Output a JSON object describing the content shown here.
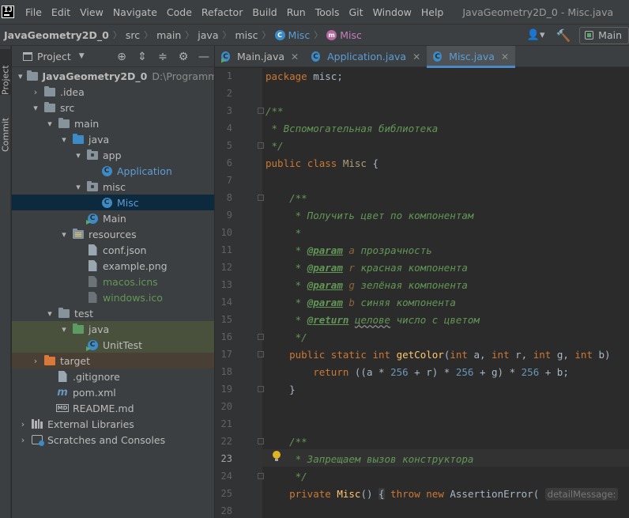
{
  "menubar": {
    "items": [
      "File",
      "Edit",
      "View",
      "Navigate",
      "Code",
      "Refactor",
      "Build",
      "Run",
      "Tools",
      "Git",
      "Window",
      "Help"
    ],
    "window_title": "JavaGeometry2D_0 - Misc.java"
  },
  "breadcrumb": {
    "project": "JavaGeometry2D_0",
    "parts": [
      "src",
      "main",
      "java",
      "misc"
    ],
    "class_c": "Misc",
    "class_m": "Misc"
  },
  "run_config": {
    "label": "Main"
  },
  "toolstrip": {
    "project_tab": "Project",
    "commit_tab": "Commit"
  },
  "project_panel": {
    "title": "Project",
    "tree": {
      "root_name": "JavaGeometry2D_0",
      "root_path": "D:\\Programming\\J",
      "idea": ".idea",
      "src": "src",
      "main": "main",
      "java": "java",
      "app": "app",
      "application": "Application",
      "misc": "misc",
      "misc_class": "Misc",
      "main_class": "Main",
      "resources": "resources",
      "conf": "conf.json",
      "example": "example.png",
      "macos": "macos.icns",
      "windows": "windows.ico",
      "test": "test",
      "test_java": "java",
      "unittest": "UnitTest",
      "target": "target",
      "gitignore": ".gitignore",
      "pom": "pom.xml",
      "readme": "README.md",
      "external": "External Libraries",
      "scratches": "Scratches and Consoles"
    }
  },
  "editor_tabs": [
    {
      "label": "Main.java"
    },
    {
      "label": "Application.java"
    },
    {
      "label": "Misc.java"
    }
  ],
  "editor": {
    "current_line": 23,
    "line_numbers": [
      "1",
      "2",
      "3",
      "4",
      "5",
      "6",
      "7",
      "8",
      "9",
      "10",
      "11",
      "12",
      "13",
      "14",
      "15",
      "16",
      "17",
      "18",
      "19",
      "20",
      "21",
      "22",
      "23",
      "24",
      "25",
      "28"
    ],
    "code": {
      "l1_kw": "package",
      "l1_rest": " misc;",
      "l3": "/**",
      "l4": " * Вспомогательная библиотека",
      "l5": " */",
      "l6_kw1": "public",
      "l6_kw2": "class",
      "l6_name": "Misc",
      "l6_rest": " {",
      "l8": "/**",
      "l9": " * Получить цвет по компонентам",
      "l10": " *",
      "p_tag": "@param",
      "l11_p": "a",
      "l11_t": " прозрачность",
      "l12_p": "r",
      "l12_t": " красная компонента",
      "l13_p": "g",
      "l13_t": " зелёная компонента",
      "l14_p": "b",
      "l14_t": " синяя компонента",
      "l15_tag": "@return",
      "l15_w": "целове",
      "l15_t": " число с цветом",
      "l16": " */",
      "l17_kw1": "public",
      "l17_kw2": "static",
      "l17_kw3": "int",
      "l17_fn": "getColor",
      "l17_p1": "(",
      "l17_t1": "int",
      "l17_a1": " a, ",
      "l17_t2": "int",
      "l17_a2": " r, ",
      "l17_t3": "int",
      "l17_a3": " g, ",
      "l17_t4": "int",
      "l17_a4": " b)",
      "l18_kw": "return",
      "l18_a": " ((a * ",
      "l18_n1": "256",
      "l18_b": " + r) * ",
      "l18_n2": "256",
      "l18_c": " + g) * ",
      "l18_n3": "256",
      "l18_d": " + b;",
      "l19": "}",
      "l22": "/**",
      "l23": " * Запрещаем вызов конструктора",
      "l24": " */",
      "l25_kw": "private",
      "l25_name": "Misc",
      "l25_p": "()",
      "l25_brace": "{",
      "l25_kw2": "throw",
      "l25_kw3": "new",
      "l25_cls": "AssertionError(",
      "l25_hint": "detailMessage:"
    }
  }
}
